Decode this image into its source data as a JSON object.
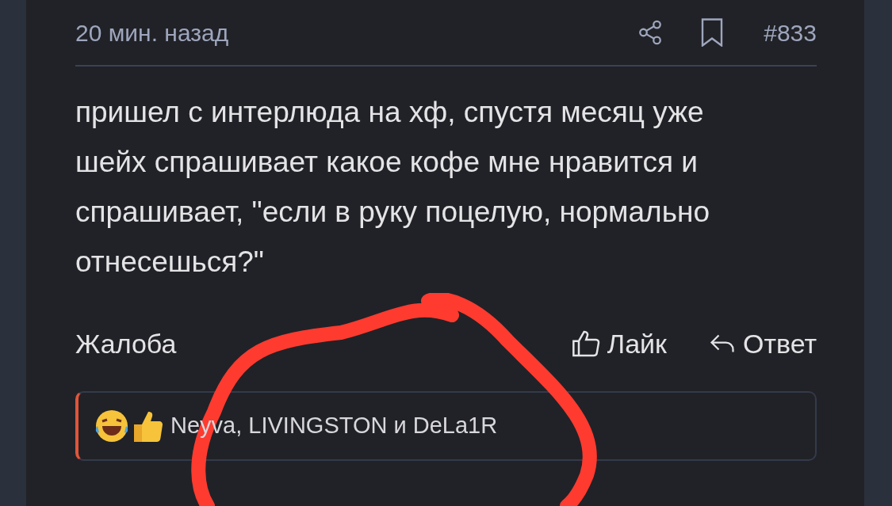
{
  "post": {
    "time": "20 мин. назад",
    "number": "#833",
    "text": "пришел с интерлюда на хф, спустя месяц уже шейх спрашивает какое кофе мне нравится и спрашивает, \"если в руку поцелую, нормально отнесешься?\"",
    "actions": {
      "report": "Жалоба",
      "like": "Лайк",
      "reply": "Ответ"
    },
    "reactions": {
      "users": "Neyva, LIVINGSTON и DeLa1R"
    }
  }
}
